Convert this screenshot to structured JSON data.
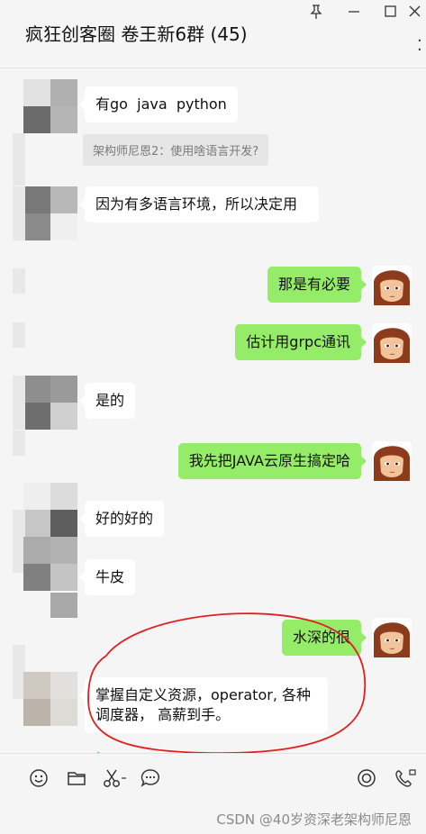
{
  "window": {
    "title": "疯狂创客圈 卷王新6群 (45)",
    "controls": [
      "pin-icon",
      "minimize-icon",
      "maximize-icon",
      "close-icon"
    ]
  },
  "messages": [
    {
      "side": "left",
      "text": "有go  java  python"
    },
    {
      "type": "quote",
      "text": "架构师尼恩2：使用啥语言开发?"
    },
    {
      "side": "left",
      "text": "因为有多语言环境，所以决定用"
    },
    {
      "side": "right",
      "text": "那是有必要"
    },
    {
      "side": "right",
      "text": "估计用grpc通讯"
    },
    {
      "side": "left",
      "text": "是的"
    },
    {
      "side": "right",
      "text": "我先把JAVA云原生搞定哈"
    },
    {
      "side": "left",
      "text": "好的好的"
    },
    {
      "side": "left",
      "text": "牛皮"
    },
    {
      "side": "right",
      "text": "水深的很"
    },
    {
      "side": "left",
      "text": "掌握自定义资源，operator, 各种调度器， 高薪到手。"
    }
  ],
  "toolbar": {
    "left_icons": [
      "emoji-icon",
      "folder-icon",
      "scissors-icon",
      "chat-history-icon"
    ],
    "right_icons": [
      "voice-call-icon",
      "video-call-icon"
    ]
  },
  "watermark": "CSDN @40岁资深老架构师尼恩",
  "colors": {
    "my_bubble": "#95ec69",
    "other_bubble": "#ffffff",
    "background": "#f5f5f5",
    "annotation": "#e02020"
  }
}
